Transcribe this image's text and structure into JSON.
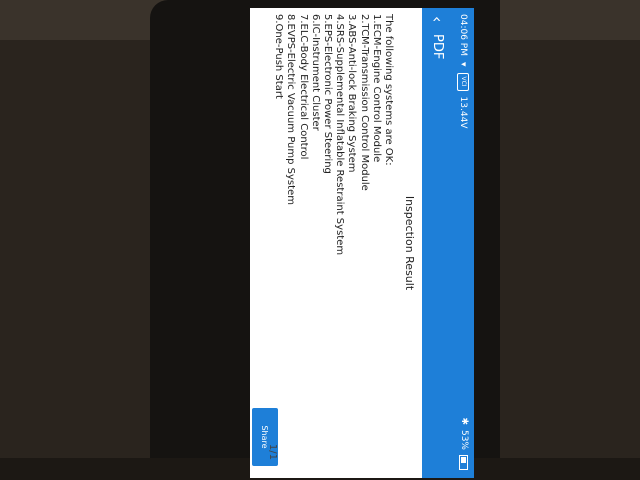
{
  "status_bar": {
    "time": "04:06 PM",
    "vci_label": "VCI",
    "voltage": "13.44V",
    "battery_percent": "53%"
  },
  "nav": {
    "title": "PDF"
  },
  "report": {
    "title": "Inspection Result",
    "intro": "The following systems are OK:",
    "systems": [
      "1.ECM-Engine Control Module",
      "2.TCM-Transmission Control Module",
      "3.ABS-Anti-lock Braking System",
      "4.SRS-Supplemental Inflatable Restraint System",
      "5.EPS-Electronic Power Steering",
      "6.IC-Instrument Cluster",
      "7.ELC-Body Electrical Control",
      "8.EVPS-Electric Vacuum Pump System",
      "9.One-Push Start"
    ]
  },
  "pager": {
    "label": "1/1"
  },
  "actions": {
    "share_label": "Share"
  },
  "colors": {
    "accent": "#1e7fd8",
    "text": "#222222",
    "background": "#ffffff"
  }
}
